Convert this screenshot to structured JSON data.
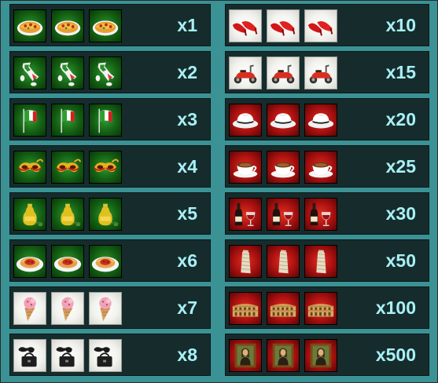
{
  "symbols_left": [
    {
      "icon": "pizza-icon",
      "bg": "green",
      "multiplier": "x1"
    },
    {
      "icon": "italy-map-icon",
      "bg": "green",
      "multiplier": "x2"
    },
    {
      "icon": "italian-flag-icon",
      "bg": "green",
      "multiplier": "x3"
    },
    {
      "icon": "carnival-mask-icon",
      "bg": "green",
      "multiplier": "x4"
    },
    {
      "icon": "olive-oil-icon",
      "bg": "green",
      "multiplier": "x5"
    },
    {
      "icon": "spaghetti-icon",
      "bg": "green",
      "multiplier": "x6"
    },
    {
      "icon": "gelato-cone-icon",
      "bg": "white",
      "multiplier": "x7"
    },
    {
      "icon": "sunglasses-handbag-icon",
      "bg": "white",
      "multiplier": "x8"
    }
  ],
  "symbols_right": [
    {
      "icon": "red-heels-icon",
      "bg": "white",
      "multiplier": "x10"
    },
    {
      "icon": "vespa-scooter-icon",
      "bg": "white",
      "multiplier": "x15"
    },
    {
      "icon": "fedora-hat-icon",
      "bg": "red",
      "multiplier": "x20"
    },
    {
      "icon": "espresso-cup-icon",
      "bg": "red",
      "multiplier": "x25"
    },
    {
      "icon": "wine-bottle-glass-icon",
      "bg": "red",
      "multiplier": "x30"
    },
    {
      "icon": "leaning-tower-icon",
      "bg": "red",
      "multiplier": "x50"
    },
    {
      "icon": "colosseum-icon",
      "bg": "red",
      "multiplier": "x100"
    },
    {
      "icon": "mona-lisa-icon",
      "bg": "red",
      "multiplier": "x500"
    }
  ],
  "colors": {
    "background": "#3a9295",
    "row": "#162c2c",
    "multiplier_text": "#a8f0f6",
    "tile_green": "#146014",
    "tile_red": "#a81010",
    "tile_white": "#f2f2ee"
  }
}
